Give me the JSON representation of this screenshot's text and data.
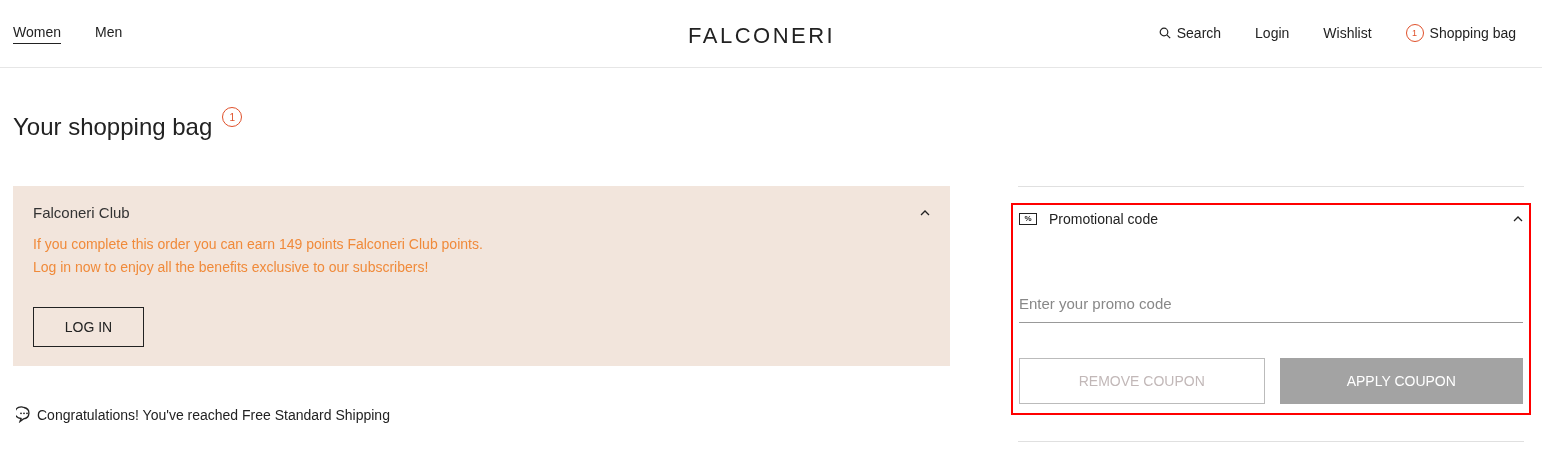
{
  "header": {
    "nav": [
      {
        "label": "Women",
        "selected": true
      },
      {
        "label": "Men",
        "selected": false
      }
    ],
    "logo": "FALCONERI",
    "actions": [
      {
        "kind": "search",
        "label": "Search"
      },
      {
        "kind": "link",
        "label": "Login"
      },
      {
        "kind": "link",
        "label": "Wishlist"
      },
      {
        "kind": "bag",
        "label": "Shopping bag",
        "count": "1"
      }
    ]
  },
  "title": {
    "text": "Your shopping bag",
    "count": "1"
  },
  "club": {
    "title": "Falconeri Club",
    "expanded": true,
    "lines": [
      "If you complete this order you can earn 149 points Falconeri Club points.",
      "Log in now to enjoy all the benefits exclusive to our subscribers!"
    ],
    "button": "LOG IN"
  },
  "shipping_note": "Congratulations! You've reached Free Standard Shipping",
  "promo": {
    "icon": "%",
    "title": "Promotional code",
    "expanded": true,
    "highlighted": true,
    "placeholder": "Enter your promo code",
    "buttons": [
      {
        "kind": "outline",
        "label": "REMOVE COUPON",
        "disabled": true
      },
      {
        "kind": "filled",
        "label": "APPLY COUPON",
        "disabled": true
      }
    ]
  }
}
